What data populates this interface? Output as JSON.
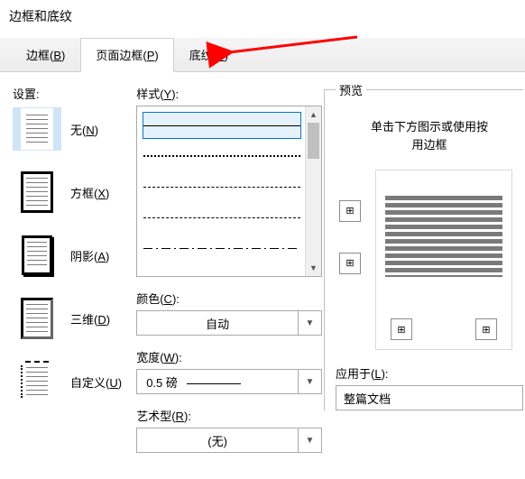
{
  "dialog_title": "边框和底纹",
  "tabs": [
    {
      "label": "边框(",
      "key": "B",
      "tail": ")"
    },
    {
      "label": "页面边框(",
      "key": "P",
      "tail": ")"
    },
    {
      "label": "底纹(",
      "key": "S",
      "tail": ")"
    }
  ],
  "settings": {
    "label": "设置:",
    "items": [
      {
        "label": "无(",
        "key": "N",
        "tail": ")"
      },
      {
        "label": "方框(",
        "key": "X",
        "tail": ")"
      },
      {
        "label": "阴影(",
        "key": "A",
        "tail": ")"
      },
      {
        "label": "三维(",
        "key": "D",
        "tail": ")"
      },
      {
        "label": "自定义(",
        "key": "U",
        "tail": ")"
      }
    ]
  },
  "style": {
    "label": "样式(",
    "key": "Y",
    "tail": "):"
  },
  "color": {
    "label": "颜色(",
    "key": "C",
    "tail": "):",
    "value": "自动"
  },
  "width": {
    "label": "宽度(",
    "key": "W",
    "tail": "):",
    "value": "0.5 磅"
  },
  "art": {
    "label": "艺术型(",
    "key": "R",
    "tail": "):",
    "value": "(无)"
  },
  "preview": {
    "legend": "预览",
    "hint1": "单击下方图示或使用按",
    "hint2": "用边框"
  },
  "apply": {
    "label": "应用于(",
    "key": "L",
    "tail": "):",
    "value": "整篇文档"
  }
}
